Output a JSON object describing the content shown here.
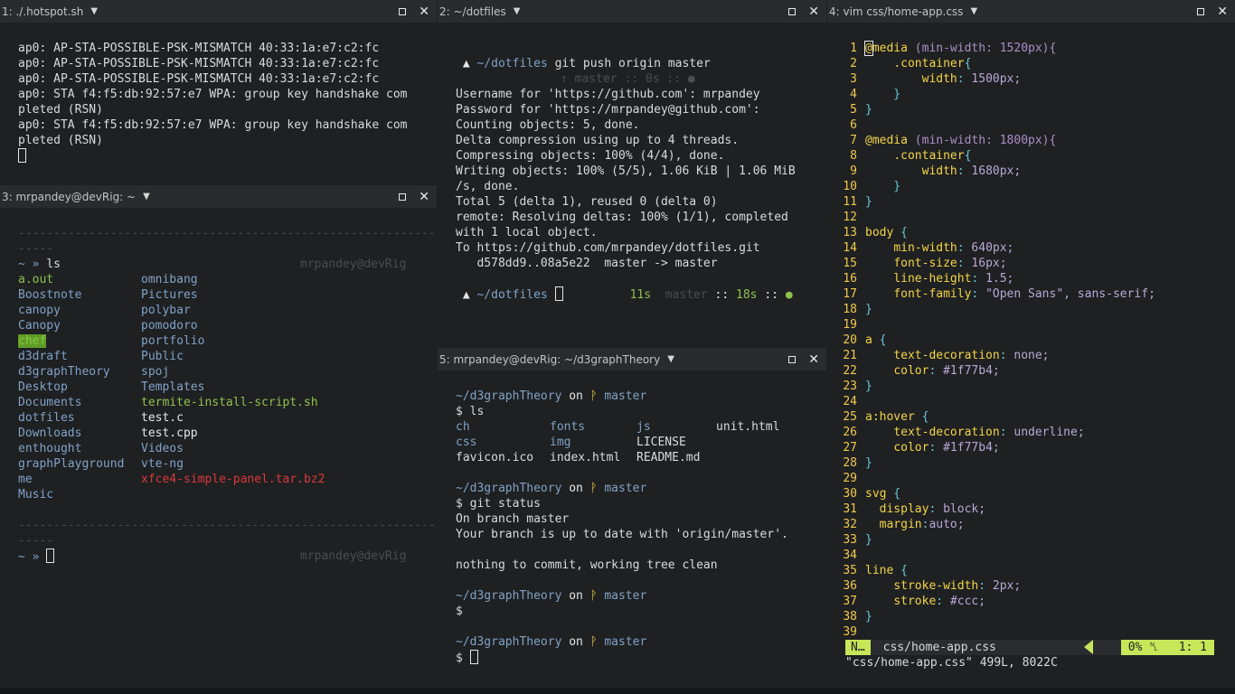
{
  "panes": {
    "p1": {
      "title": "1: ./.hotspot.sh",
      "lines": [
        "ap0: AP-STA-POSSIBLE-PSK-MISMATCH 40:33:1a:e7:c2:fc",
        "ap0: AP-STA-POSSIBLE-PSK-MISMATCH 40:33:1a:e7:c2:fc",
        "ap0: AP-STA-POSSIBLE-PSK-MISMATCH 40:33:1a:e7:c2:fc",
        "ap0: STA f4:f5:db:92:57:e7 WPA: group key handshake com",
        "pleted (RSN)",
        "ap0: STA f4:f5:db:92:57:e7 WPA: group key handshake com",
        "pleted (RSN)"
      ]
    },
    "p2": {
      "title": "2: ~/dotfiles",
      "prompt_dir": "~/dotfiles",
      "command": "git push origin master",
      "status_line": "↑ master :: 0s :: ●",
      "output": [
        "Username for 'https://github.com': mrpandey",
        "Password for 'https://mrpandey@github.com':",
        "Counting objects: 5, done.",
        "Delta compression using up to 4 threads.",
        "Compressing objects: 100% (4/4), done.",
        "Writing objects: 100% (5/5), 1.06 KiB | 1.06 MiB",
        "/s, done.",
        "Total 5 (delta 1), reused 0 (delta 0)",
        "remote: Resolving deltas: 100% (1/1), completed",
        "with 1 local object.",
        "To https://github.com/mrpandey/dotfiles.git",
        "   d578dd9..08a5e22  master -> master"
      ],
      "prompt2_dir": "~/dotfiles",
      "prompt2_right_time": "11s",
      "prompt2_right_branch": "master",
      "prompt2_right_sep": "::",
      "prompt2_right_time2": "18s",
      "prompt2_right_sep2": "::",
      "prompt2_dot": "●"
    },
    "p3": {
      "title": "3: mrpandey@devRig: ~",
      "separator": "-----------------------------------------------------------",
      "separator2": "-----",
      "prompt": "~ »",
      "command": "ls",
      "host": "mrpandey@devRig",
      "col1": [
        "a.out",
        "Boostnote",
        "canopy",
        "Canopy",
        "chef",
        "d3draft",
        "d3graphTheory",
        "Desktop",
        "Documents",
        "dotfiles",
        "Downloads",
        "enthought",
        "graphPlayground",
        "me",
        "Music"
      ],
      "col2": [
        "omnibang",
        "Pictures",
        "polybar",
        "pomodoro",
        "portfolio",
        "Public",
        "spoj",
        "Templates",
        "termite-install-script.sh",
        "test.c",
        "test.cpp",
        "Videos",
        "vte-ng",
        "xfce4-simple-panel.tar.bz2"
      ]
    },
    "p5": {
      "title": "5: mrpandey@devRig: ~/d3graphTheory",
      "dir": "~/d3graphTheory",
      "on": "on",
      "branch_icon": "ᚹ",
      "branch": "master",
      "cmd1": "ls",
      "ls": [
        [
          "ch",
          "fonts",
          "js",
          "unit.html"
        ],
        [
          "css",
          "img",
          "LICENSE",
          ""
        ],
        [
          "favicon.ico",
          "index.html",
          "README.md",
          ""
        ]
      ],
      "cmd2": "git status",
      "status_lines": [
        "On branch master",
        "Your branch is up to date with 'origin/master'.",
        "",
        "nothing to commit, working tree clean"
      ],
      "dollar": "$"
    },
    "p4": {
      "title": "4: vim css/home-app.css",
      "status_mode": "N…",
      "status_file": "css/home-app.css",
      "status_pct": "0% ␤",
      "status_pos": "1:  1",
      "message": "\"css/home-app.css\" 499L, 8022C",
      "code": [
        "@media (min-width: 1520px){",
        "    .container{",
        "        width: 1500px;",
        "    }",
        "}",
        "",
        "@media (min-width: 1800px){",
        "    .container{",
        "        width: 1680px;",
        "    }",
        "}",
        "",
        "body {",
        "    min-width: 640px;",
        "    font-size: 16px;",
        "    line-height: 1.5;",
        "    font-family: \"Open Sans\", sans-serif;",
        "}",
        "",
        "a {",
        "    text-decoration: none;",
        "    color: #1f77b4;",
        "}",
        "",
        "a:hover {",
        "    text-decoration: underline;",
        "    color: #1f77b4;",
        "}",
        "",
        "svg {",
        "  display: block;",
        "  margin:auto;",
        "}",
        "",
        "line {",
        "    stroke-width: 2px;",
        "    stroke: #ccc;",
        "}",
        ""
      ]
    }
  }
}
